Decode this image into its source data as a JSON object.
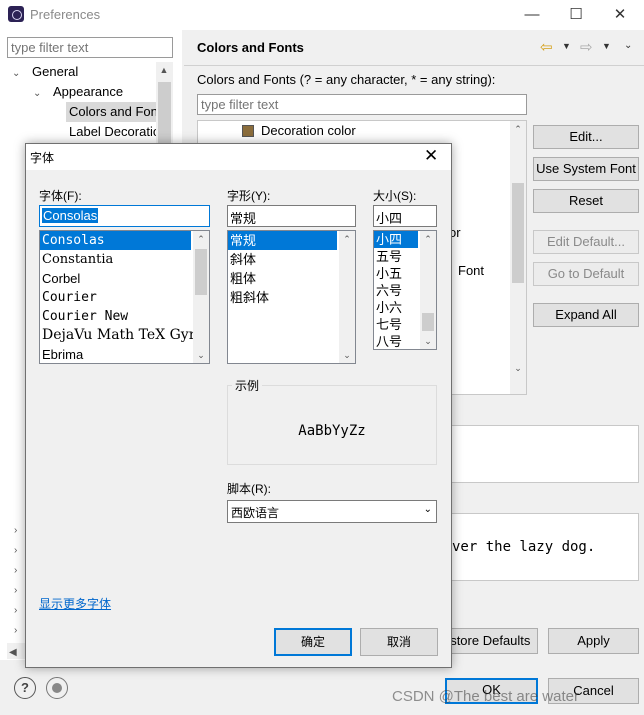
{
  "window": {
    "title": "Preferences"
  },
  "left": {
    "filter_placeholder": "type filter text",
    "tree": [
      {
        "label": "General"
      },
      {
        "label": "Appearance"
      },
      {
        "label": "Colors and Fonts"
      },
      {
        "label": "Label Decorations"
      }
    ]
  },
  "right": {
    "title": "Colors and Fonts",
    "description": "Colors and Fonts (? = any character, * = any string):",
    "filter_placeholder": "type filter text",
    "tree_item": "Decoration color",
    "partial_or": "or",
    "partial_font": "Font",
    "preview_text": "ver the lazy dog.",
    "buttons": {
      "edit": "Edit...",
      "use_system_font": "Use System Font",
      "reset": "Reset",
      "edit_default": "Edit Default...",
      "go_to_default": "Go to Default",
      "expand_all": "Expand All",
      "restore_defaults": "Restore Defaults",
      "apply": "Apply"
    }
  },
  "footer": {
    "ok": "OK",
    "cancel": "Cancel",
    "watermark": "CSDN @The best are water"
  },
  "font_dialog": {
    "title": "字体",
    "font_label": "字体(F):",
    "font_value": "Consolas",
    "fonts": [
      "Consolas",
      "Constantia",
      "Corbel",
      "Courier",
      "Courier New",
      "DejaVu Math TeX Gyre",
      "Ebrima"
    ],
    "style_label": "字形(Y):",
    "style_value": "常规",
    "styles": [
      "常规",
      "斜体",
      "粗体",
      "粗斜体"
    ],
    "size_label": "大小(S):",
    "size_value": "小四",
    "sizes": [
      "小四",
      "五号",
      "小五",
      "六号",
      "小六",
      "七号",
      "八号"
    ],
    "sample_label": "示例",
    "sample_text": "AaBbYyZz",
    "script_label": "脚本(R):",
    "script_value": "西欧语言",
    "more_fonts": "显示更多字体",
    "ok": "确定",
    "cancel": "取消"
  }
}
